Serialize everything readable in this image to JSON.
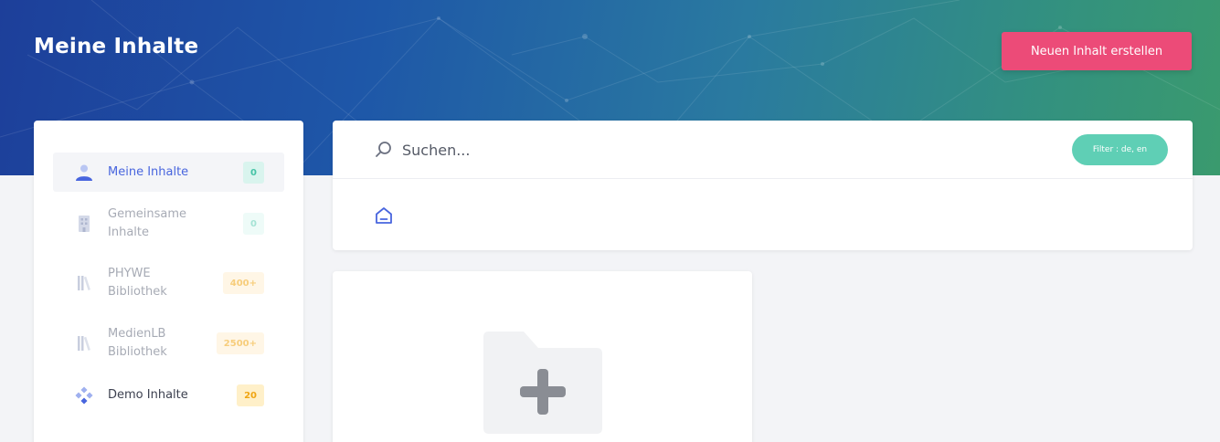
{
  "header": {
    "title": "Meine Inhalte",
    "new_content_label": "Neuen Inhalt erstellen"
  },
  "sidebar": {
    "items": [
      {
        "label_line1": "Meine Inhalte",
        "label_line2": "",
        "count": "0",
        "icon": "user-icon",
        "active": true
      },
      {
        "label_line1": "Gemeinsame",
        "label_line2": "Inhalte",
        "count": "0",
        "icon": "building-icon",
        "active": false
      },
      {
        "label_line1": "PHYWE",
        "label_line2": "Bibliothek",
        "count": "400+",
        "icon": "library-icon",
        "active": false
      },
      {
        "label_line1": "MedienLB",
        "label_line2": "Bibliothek",
        "count": "2500+",
        "icon": "library-icon",
        "active": false
      },
      {
        "label_line1": "Demo Inhalte",
        "label_line2": "",
        "count": "20",
        "icon": "diamond-dots-icon",
        "active": false
      }
    ]
  },
  "search": {
    "placeholder": "Suchen...",
    "filter_label": "Filter : de, en"
  },
  "colors": {
    "accent_pink": "#ec4b78",
    "accent_blue": "#4865de",
    "accent_teal": "#5fcfb5",
    "badge_orange": "#f0a512"
  }
}
